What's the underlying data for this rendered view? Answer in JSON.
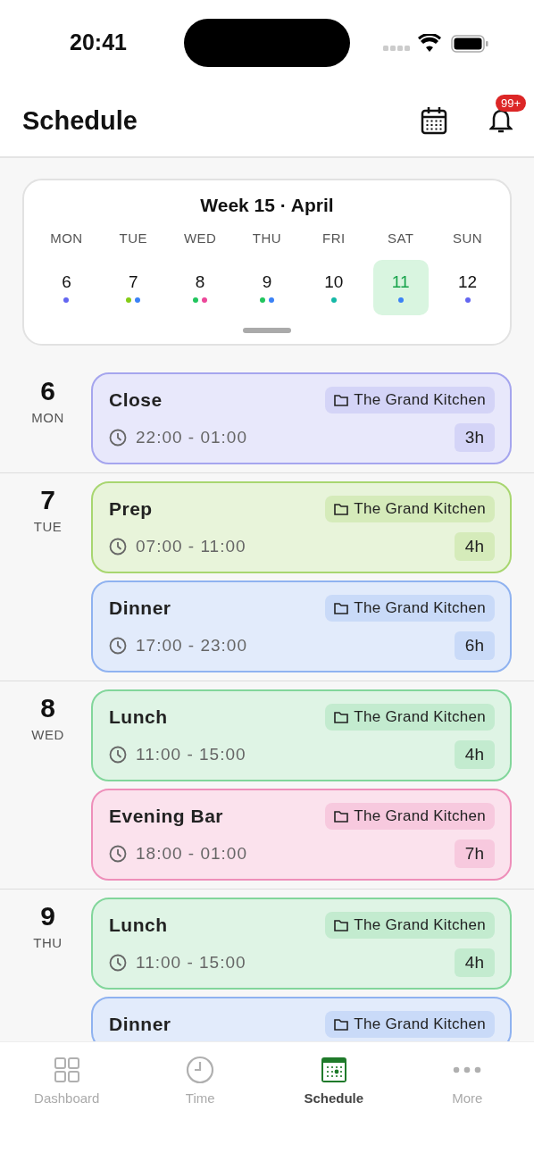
{
  "status_bar": {
    "time": "20:41"
  },
  "header": {
    "title": "Schedule",
    "notification_badge": "99+"
  },
  "week": {
    "title": "Week 15 · April",
    "days": [
      {
        "weekday": "MON",
        "date": "6",
        "selected": false,
        "dots": [
          {
            "color": "#6366f1"
          }
        ]
      },
      {
        "weekday": "TUE",
        "date": "7",
        "selected": false,
        "dots": [
          {
            "color": "#84cc16"
          },
          {
            "color": "#3b82f6"
          }
        ]
      },
      {
        "weekday": "WED",
        "date": "8",
        "selected": false,
        "dots": [
          {
            "color": "#22c55e"
          },
          {
            "color": "#ec4899"
          }
        ]
      },
      {
        "weekday": "THU",
        "date": "9",
        "selected": false,
        "dots": [
          {
            "color": "#22c55e"
          },
          {
            "color": "#3b82f6"
          }
        ]
      },
      {
        "weekday": "FRI",
        "date": "10",
        "selected": false,
        "dots": [
          {
            "color": "#14b8a6"
          }
        ]
      },
      {
        "weekday": "SAT",
        "date": "11",
        "selected": true,
        "dots": [
          {
            "color": "#3b82f6"
          }
        ]
      },
      {
        "weekday": "SUN",
        "date": "12",
        "selected": false,
        "dots": [
          {
            "color": "#6366f1"
          }
        ]
      }
    ]
  },
  "schedule": [
    {
      "date": "6",
      "weekday": "MON",
      "shifts": [
        {
          "title": "Close",
          "location": "The Grand Kitchen",
          "time": "22:00 - 01:00",
          "hours": "3h",
          "color": "#a5a5ee"
        }
      ]
    },
    {
      "date": "7",
      "weekday": "TUE",
      "shifts": [
        {
          "title": "Prep",
          "location": "The Grand Kitchen",
          "time": "07:00 - 11:00",
          "hours": "4h",
          "color": "#a8d670"
        },
        {
          "title": "Dinner",
          "location": "The Grand Kitchen",
          "time": "17:00 - 23:00",
          "hours": "6h",
          "color": "#8fb2f0"
        }
      ]
    },
    {
      "date": "8",
      "weekday": "WED",
      "shifts": [
        {
          "title": "Lunch",
          "location": "The Grand Kitchen",
          "time": "11:00 - 15:00",
          "hours": "4h",
          "color": "#82d69b"
        },
        {
          "title": "Evening Bar",
          "location": "The Grand Kitchen",
          "time": "18:00 - 01:00",
          "hours": "7h",
          "color": "#ee8fba"
        }
      ]
    },
    {
      "date": "9",
      "weekday": "THU",
      "shifts": [
        {
          "title": "Lunch",
          "location": "The Grand Kitchen",
          "time": "11:00 - 15:00",
          "hours": "4h",
          "color": "#82d69b"
        },
        {
          "title": "Dinner",
          "location": "The Grand Kitchen",
          "color": "#8fb2f0"
        }
      ]
    }
  ],
  "tab_bar": [
    {
      "kind": "grid",
      "label": "Dashboard",
      "selected": false
    },
    {
      "kind": "clock",
      "label": "Time",
      "selected": false
    },
    {
      "kind": "calendar",
      "label": "Schedule",
      "selected": true
    },
    {
      "kind": "dots",
      "label": "More",
      "selected": false
    }
  ]
}
